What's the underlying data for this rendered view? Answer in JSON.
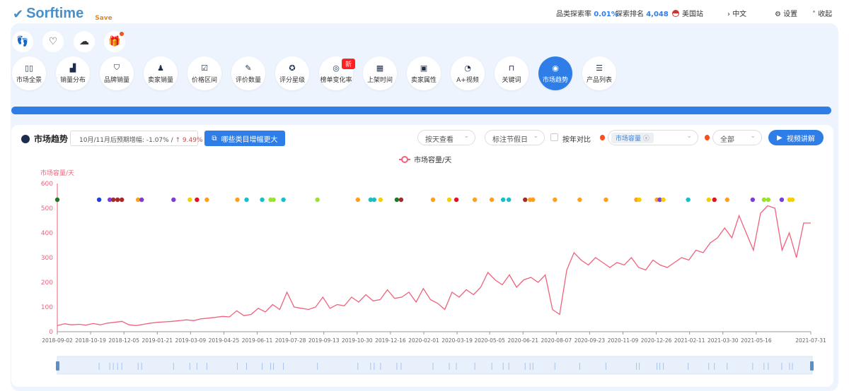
{
  "header": {
    "brand": "Sorftime",
    "save": "Save",
    "search_rate_label": "品类探索率",
    "search_rate": "0.01%",
    "rank_label": "探索排名",
    "rank": "4,048",
    "site": "美国站",
    "lang": "中文",
    "settings": "设置",
    "collapse": "收起"
  },
  "quick_icons": [
    "footprint-icon",
    "heart-icon",
    "cloud-download-icon",
    "gift-icon"
  ],
  "nav": [
    {
      "label": "市场全景",
      "icon": "▯▯"
    },
    {
      "label": "销量分布",
      "icon": "▟"
    },
    {
      "label": "品牌销量",
      "icon": "⛉"
    },
    {
      "label": "卖家销量",
      "icon": "♟"
    },
    {
      "label": "价格区间",
      "icon": "☑"
    },
    {
      "label": "评价数量",
      "icon": "✎"
    },
    {
      "label": "评分星级",
      "icon": "✪"
    },
    {
      "label": "榜单变化率",
      "icon": "◎"
    },
    {
      "label": "上架时间",
      "icon": "▦"
    },
    {
      "label": "卖家属性",
      "icon": "▣"
    },
    {
      "label": "A+视频",
      "icon": "◔"
    },
    {
      "label": "关键词",
      "icon": "⊓"
    },
    {
      "label": "市场趋势",
      "icon": "◉",
      "active": true
    },
    {
      "label": "产品列表",
      "icon": "☰"
    }
  ],
  "nav_badge": "新",
  "progress": 100,
  "trend": {
    "title": "市场趋势",
    "forecast_label": "10月/11月后预期增幅:",
    "forecast_down": "-1.07%",
    "sep": "/",
    "forecast_up": "↑ 9.49%",
    "growth_button": "哪些类目增幅更大",
    "view_select": "按天查看",
    "holiday_select": "标注节假日",
    "yoy_label": "按年对比",
    "metric_tag": "市场容量",
    "range_select": "全部",
    "video_button": "视频讲解"
  },
  "colors": {
    "accent": "#2f7ee8",
    "line": "#f0627c"
  },
  "chart_data": {
    "type": "line",
    "title": "",
    "legend": "市场容量/天",
    "legend_position": "top-center",
    "ylabel": "市场容量/天",
    "ylim": [
      0,
      600
    ],
    "yticks": [
      0,
      100,
      200,
      300,
      400,
      500,
      600
    ],
    "x_start": "2018-09-02",
    "x_end": "2021-07-31",
    "x_days": 1063,
    "xticks": [
      {
        "day": 0,
        "label": "2018-09-02"
      },
      {
        "day": 47,
        "label": "2018-10-19"
      },
      {
        "day": 94,
        "label": "2018-12-05"
      },
      {
        "day": 141,
        "label": "2019-01-21"
      },
      {
        "day": 188,
        "label": "2019-03-09"
      },
      {
        "day": 235,
        "label": "2019-04-25"
      },
      {
        "day": 282,
        "label": "2019-06-11"
      },
      {
        "day": 329,
        "label": "2019-07-28"
      },
      {
        "day": 376,
        "label": "2019-09-13"
      },
      {
        "day": 423,
        "label": "2019-10-30"
      },
      {
        "day": 470,
        "label": "2019-12-16"
      },
      {
        "day": 517,
        "label": "2020-02-01"
      },
      {
        "day": 564,
        "label": "2020-03-19"
      },
      {
        "day": 610,
        "label": "2020-05-05"
      },
      {
        "day": 657,
        "label": "2020-06-21"
      },
      {
        "day": 704,
        "label": "2020-08-07"
      },
      {
        "day": 751,
        "label": "2020-09-23"
      },
      {
        "day": 798,
        "label": "2020-11-09"
      },
      {
        "day": 845,
        "label": "2020-12-26"
      },
      {
        "day": 892,
        "label": "2021-02-11"
      },
      {
        "day": 939,
        "label": "2021-03-30"
      },
      {
        "day": 986,
        "label": "2021-05-16"
      },
      {
        "day": 1063,
        "label": "2021-07-31"
      }
    ],
    "series": [
      {
        "name": "市场容量/天",
        "values": [
          25,
          32,
          28,
          30,
          27,
          33,
          28,
          35,
          38,
          42,
          28,
          25,
          30,
          35,
          38,
          40,
          42,
          45,
          48,
          45,
          52,
          55,
          58,
          62,
          60,
          85,
          65,
          70,
          95,
          80,
          110,
          90,
          160,
          100,
          95,
          90,
          100,
          140,
          95,
          110,
          105,
          140,
          120,
          150,
          125,
          130,
          170,
          135,
          140,
          160,
          120,
          175,
          130,
          115,
          90,
          160,
          140,
          170,
          150,
          180,
          240,
          210,
          190,
          230,
          180,
          210,
          220,
          200,
          230,
          90,
          70,
          250,
          320,
          290,
          270,
          300,
          280,
          260,
          280,
          270,
          300,
          260,
          250,
          290,
          270,
          260,
          280,
          300,
          290,
          330,
          320,
          360,
          380,
          420,
          380,
          470,
          400,
          330,
          480,
          510,
          500,
          330,
          400,
          300,
          440,
          440
        ]
      }
    ],
    "event_markers": [
      {
        "day": 0,
        "color": "#1b7a2a"
      },
      {
        "day": 59,
        "color": "#1f3fe0"
      },
      {
        "day": 74,
        "color": "#7b3fd6"
      },
      {
        "day": 79,
        "color": "#a52a2a"
      },
      {
        "day": 85,
        "color": "#a52a2a"
      },
      {
        "day": 91,
        "color": "#a52a2a"
      },
      {
        "day": 114,
        "color": "#ff9f1c"
      },
      {
        "day": 119,
        "color": "#7b3fd6"
      },
      {
        "day": 164,
        "color": "#7b3fd6"
      },
      {
        "day": 187,
        "color": "#f5d000"
      },
      {
        "day": 197,
        "color": "#e8101e"
      },
      {
        "day": 211,
        "color": "#ff9f1c"
      },
      {
        "day": 254,
        "color": "#ff9f1c"
      },
      {
        "day": 267,
        "color": "#17c0c8"
      },
      {
        "day": 289,
        "color": "#17c0c8"
      },
      {
        "day": 301,
        "color": "#9be22d"
      },
      {
        "day": 305,
        "color": "#9be22d"
      },
      {
        "day": 319,
        "color": "#17c0c8"
      },
      {
        "day": 367,
        "color": "#9be22d"
      },
      {
        "day": 424,
        "color": "#ff9f1c"
      },
      {
        "day": 442,
        "color": "#17c0c8"
      },
      {
        "day": 447,
        "color": "#17c0c8"
      },
      {
        "day": 456,
        "color": "#f5d000"
      },
      {
        "day": 479,
        "color": "#1b7a2a"
      },
      {
        "day": 485,
        "color": "#a52a2a"
      },
      {
        "day": 530,
        "color": "#ff9f1c"
      },
      {
        "day": 553,
        "color": "#f5d000"
      },
      {
        "day": 563,
        "color": "#e8101e"
      },
      {
        "day": 589,
        "color": "#ff9f1c"
      },
      {
        "day": 613,
        "color": "#ff9f1c"
      },
      {
        "day": 629,
        "color": "#17c0c8"
      },
      {
        "day": 637,
        "color": "#17c0c8"
      },
      {
        "day": 660,
        "color": "#a52a2a"
      },
      {
        "day": 667,
        "color": "#ff9f1c"
      },
      {
        "day": 671,
        "color": "#ff9f1c"
      },
      {
        "day": 702,
        "color": "#ff9f1c"
      },
      {
        "day": 737,
        "color": "#ff9f1c"
      },
      {
        "day": 774,
        "color": "#ff9f1c"
      },
      {
        "day": 817,
        "color": "#ff9f1c"
      },
      {
        "day": 821,
        "color": "#f5d000"
      },
      {
        "day": 846,
        "color": "#ff9f1c"
      },
      {
        "day": 850,
        "color": "#7b3fd6"
      },
      {
        "day": 855,
        "color": "#f5d000"
      },
      {
        "day": 890,
        "color": "#17c0c8"
      },
      {
        "day": 919,
        "color": "#f5d000"
      },
      {
        "day": 927,
        "color": "#e8101e"
      },
      {
        "day": 945,
        "color": "#ff9f1c"
      },
      {
        "day": 981,
        "color": "#7b3fd6"
      },
      {
        "day": 997,
        "color": "#9be22d"
      },
      {
        "day": 1003,
        "color": "#9be22d"
      },
      {
        "day": 1022,
        "color": "#7b3fd6"
      },
      {
        "day": 1033,
        "color": "#f5d000"
      },
      {
        "day": 1037,
        "color": "#f5d000"
      }
    ]
  }
}
